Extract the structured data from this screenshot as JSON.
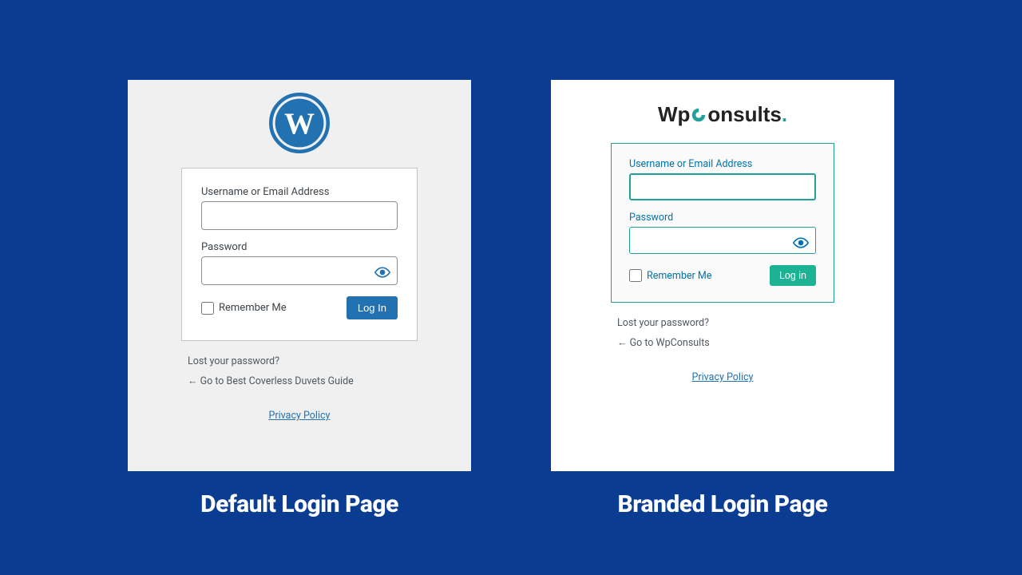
{
  "left": {
    "caption": "Default Login Page",
    "logo": "wordpress-logo",
    "form": {
      "username_label": "Username or Email Address",
      "password_label": "Password",
      "remember_label": "Remember Me",
      "login_button": "Log In"
    },
    "links": {
      "lost_password": "Lost your password?",
      "goto": "← Go to Best Coverless Duvets Guide",
      "privacy": "Privacy Policy"
    }
  },
  "right": {
    "caption": "Branded Login Page",
    "logo_text_wp": "Wp",
    "logo_text_onsults": "onsults",
    "form": {
      "username_label": "Username or Email Address",
      "password_label": "Password",
      "remember_label": "Remember Me",
      "login_button": "Log in"
    },
    "links": {
      "lost_password": "Lost your password?",
      "goto": "← Go to WpConsults",
      "privacy": "Privacy Policy"
    }
  },
  "colors": {
    "page_bg": "#0a3d91",
    "wp_blue": "#2271b1",
    "branded_teal": "#21a19a",
    "branded_btn": "#1bb394"
  }
}
